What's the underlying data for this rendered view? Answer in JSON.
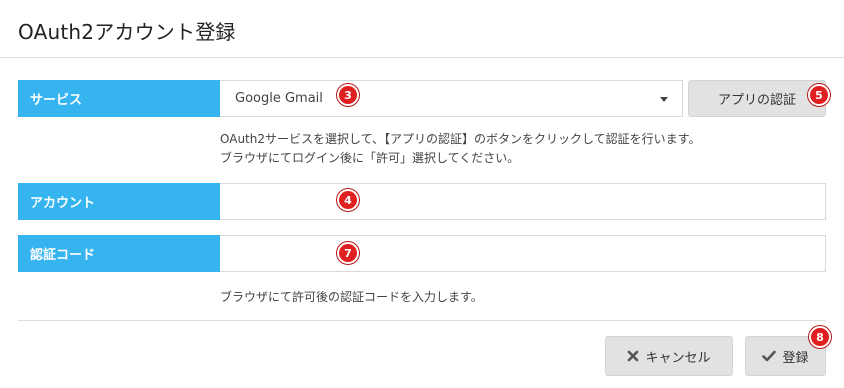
{
  "dialog": {
    "title": "OAuth2アカウント登録"
  },
  "service": {
    "label": "サービス",
    "selected": "Google Gmail",
    "auth_button": "アプリの認証",
    "help_line1": "OAuth2サービスを選択して、【アプリの認証】のボタンをクリックして認証を行います。",
    "help_line2": "ブラウザにてログイン後に「許可」選択してください。"
  },
  "account": {
    "label": "アカウント",
    "value": ""
  },
  "auth_code": {
    "label": "認証コード",
    "value": "",
    "help": "ブラウザにて許可後の認証コードを入力します。"
  },
  "footer": {
    "cancel_label": "キャンセル",
    "register_label": "登録"
  },
  "badges": {
    "service": "3",
    "auth_button": "5",
    "account": "4",
    "auth_code": "7",
    "register": "8"
  },
  "colors": {
    "label_bg": "#35b4f0",
    "badge": "#e02020",
    "button_bg": "#e2e2e2"
  }
}
